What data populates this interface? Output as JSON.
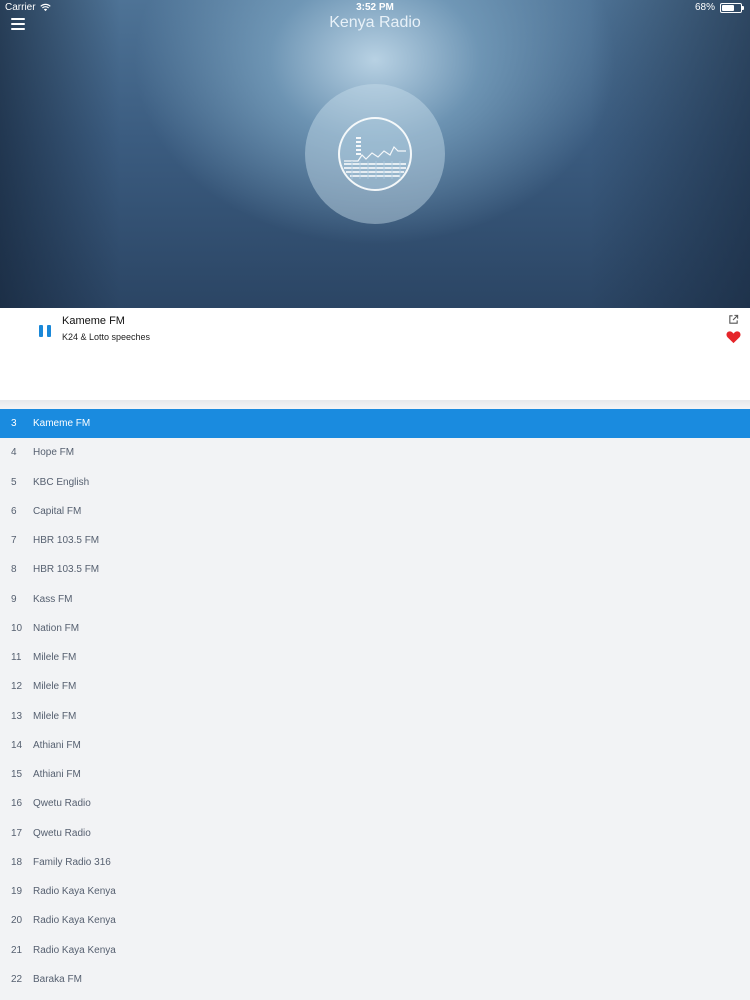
{
  "status_bar": {
    "carrier": "Carrier",
    "time": "3:52 PM",
    "battery": "68%",
    "battery_level": 0.68
  },
  "header": {
    "title": "Kenya Radio",
    "menu_icon": "hamburger-menu-icon"
  },
  "now_playing": {
    "station": "Kameme FM",
    "track": "K24 & Lotto speeches",
    "state": "playing",
    "favorite_color": "#e5252a",
    "accent_color": "#1a88d8"
  },
  "stations": [
    {
      "num": "3",
      "name": "Kameme FM",
      "active": true
    },
    {
      "num": "4",
      "name": "Hope FM"
    },
    {
      "num": "5",
      "name": "KBC English"
    },
    {
      "num": "6",
      "name": "Capital FM"
    },
    {
      "num": "7",
      "name": "HBR 103.5 FM"
    },
    {
      "num": "8",
      "name": "HBR 103.5 FM"
    },
    {
      "num": "9",
      "name": "Kass FM"
    },
    {
      "num": "10",
      "name": "Nation FM"
    },
    {
      "num": "11",
      "name": "Milele FM"
    },
    {
      "num": "12",
      "name": "Milele FM"
    },
    {
      "num": "13",
      "name": "Milele FM"
    },
    {
      "num": "14",
      "name": "Athiani FM"
    },
    {
      "num": "15",
      "name": "Athiani FM"
    },
    {
      "num": "16",
      "name": "Qwetu Radio"
    },
    {
      "num": "17",
      "name": "Qwetu Radio"
    },
    {
      "num": "18",
      "name": "Family Radio 316"
    },
    {
      "num": "19",
      "name": "Radio Kaya Kenya"
    },
    {
      "num": "20",
      "name": "Radio Kaya Kenya"
    },
    {
      "num": "21",
      "name": "Radio Kaya Kenya"
    },
    {
      "num": "22",
      "name": "Baraka FM"
    }
  ],
  "colors": {
    "active_row": "#1a8bdf",
    "list_background": "#f2f3f5"
  }
}
